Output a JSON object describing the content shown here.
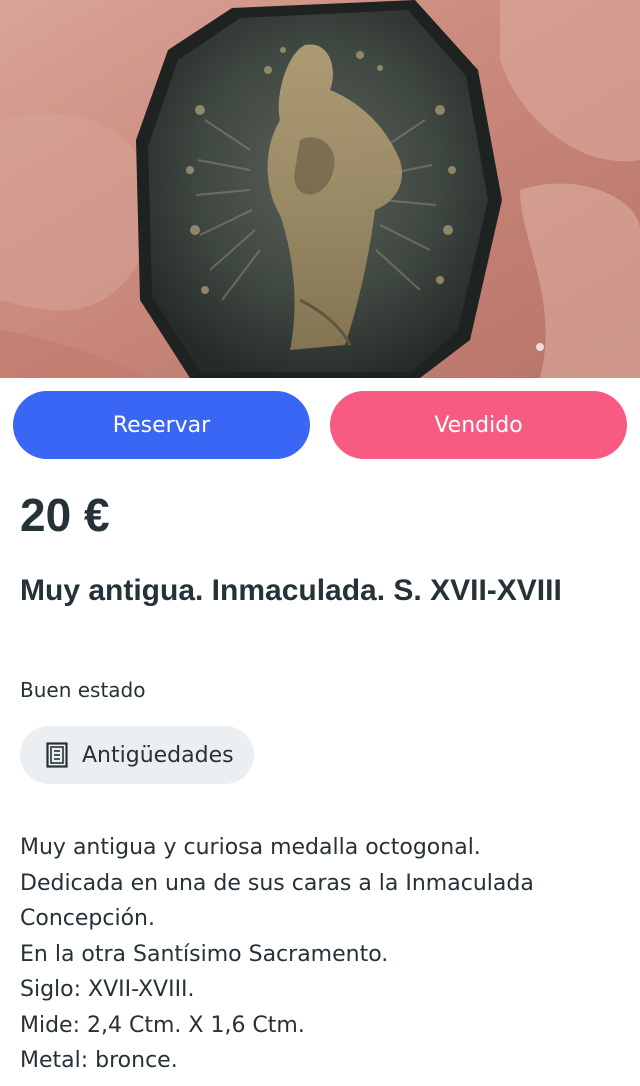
{
  "gallery": {
    "image_alt": "Medalla octogonal de bronce sostenida entre los dedos",
    "dots": 1
  },
  "actions": {
    "reserve_label": "Reservar",
    "sold_label": "Vendido"
  },
  "product": {
    "price": "20 €",
    "title": "Muy antigua. Inmaculada. S. XVII-XVIII",
    "condition": "Buen estado",
    "category": {
      "icon": "antiques-frame-icon",
      "label": "Antigüedades"
    },
    "description": [
      "Muy antigua y curiosa medalla octogonal.",
      "Dedicada en una de sus caras a la Inmaculada",
      "Concepción.",
      "En la otra Santísimo Sacramento.",
      "Siglo: XVII-XVIII.",
      "Mide: 2,4 Ctm. X 1,6 Ctm.",
      "Metal: bronce."
    ]
  },
  "colors": {
    "reserve": "#3a66f5",
    "sold": "#f75b82",
    "text": "#253238",
    "chip_bg": "#eceff1"
  }
}
